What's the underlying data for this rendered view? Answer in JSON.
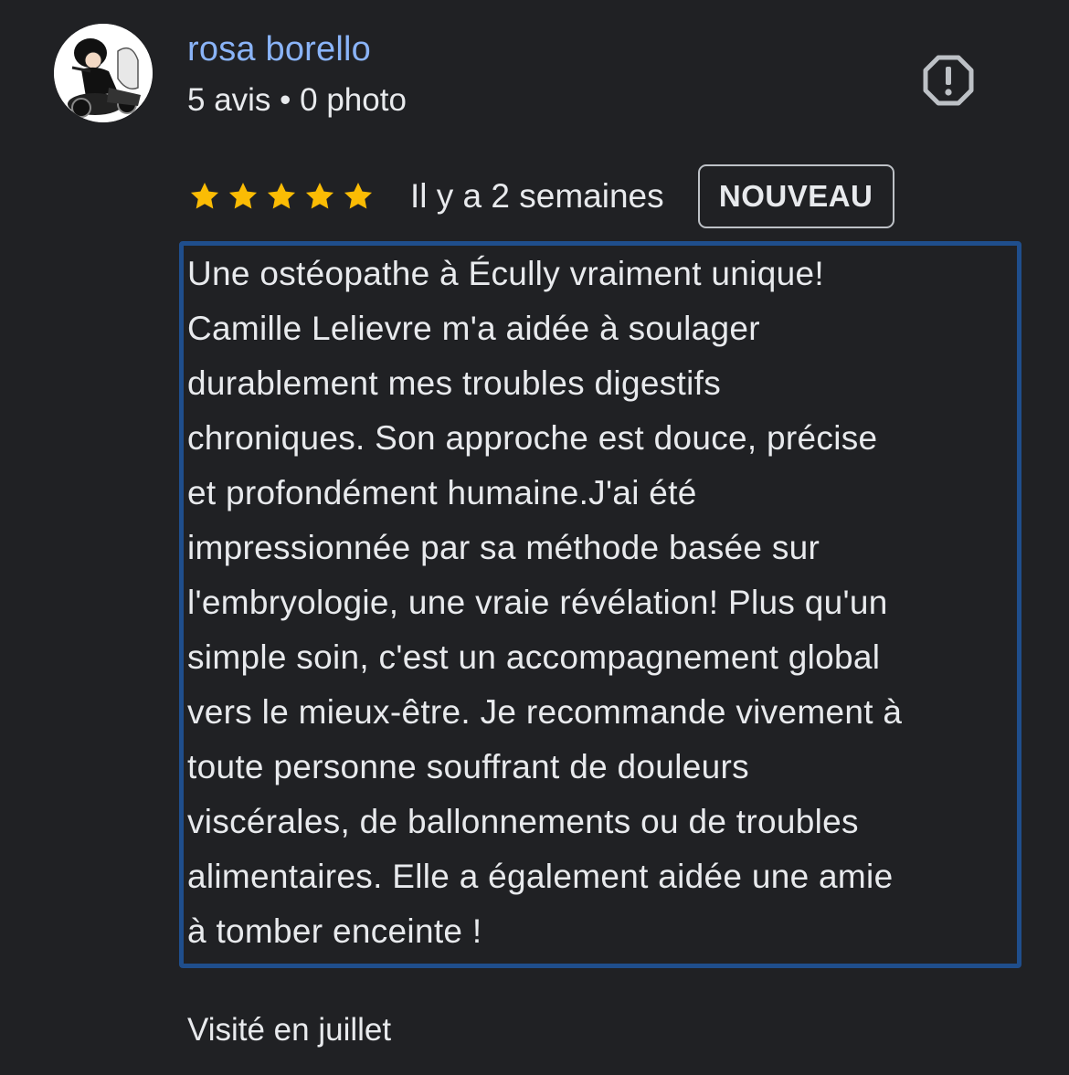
{
  "author": {
    "name": "rosa borello",
    "meta": "5 avis • 0 photo",
    "avatar_icon": "user-avatar-cartoon"
  },
  "report_icon": "report-flag-icon",
  "rating": {
    "stars": 5,
    "star_color": "#fbbc04",
    "date": "Il y a 2 semaines",
    "badge": "NOUVEAU"
  },
  "review": {
    "lines": [
      "Une ostéopathe à Écully vraiment unique!",
      "Camille Lelievre m'a aidée à soulager",
      "durablement mes troubles digestifs",
      "chroniques. Son approche est douce, précise",
      "et profondément humaine.J'ai été",
      "impressionnée par sa méthode basée sur",
      "l'embryologie, une vraie révélation! Plus qu'un",
      "simple soin, c'est un accompagnement global",
      "vers le mieux-être. Je recommande vivement à",
      "toute personne souffrant de douleurs",
      "viscérales, de ballonnements ou de troubles",
      "alimentaires. Elle a également aidée une amie",
      "à tomber enceinte !"
    ],
    "highlight_color": "#1f4e8c"
  },
  "visited": "Visité en juillet",
  "colors": {
    "background": "#202124",
    "name": "#8ab4f8",
    "text": "#e8eaed"
  }
}
